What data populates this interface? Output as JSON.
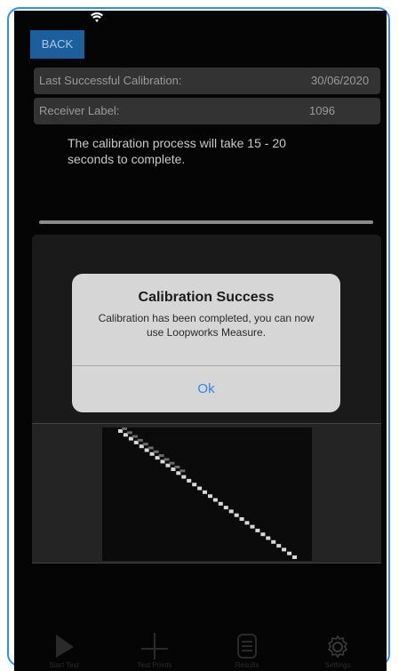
{
  "header": {
    "back_label": "BACK"
  },
  "calibration": {
    "last_label": "Last Successful Calibration:",
    "last_value": "30/06/2020",
    "receiver_label": "Receiver Label:",
    "receiver_value": "1096",
    "description": "The calibration process will take 15 - 20 seconds to complete."
  },
  "dialog": {
    "title": "Calibration Success",
    "message": "Calibration has been completed, you can now use Loopworks Measure.",
    "ok_label": "Ok"
  },
  "tabbar": {
    "items": [
      {
        "icon": "play-icon",
        "label": "Start Test"
      },
      {
        "icon": "crosshair-icon",
        "label": "Test Points"
      },
      {
        "icon": "list-icon",
        "label": "Results"
      },
      {
        "icon": "gear-icon",
        "label": "Settings"
      }
    ]
  },
  "colors": {
    "accent": "#2f86e8",
    "back_button": "#1d5e9c",
    "screen_bg": "#050505"
  }
}
